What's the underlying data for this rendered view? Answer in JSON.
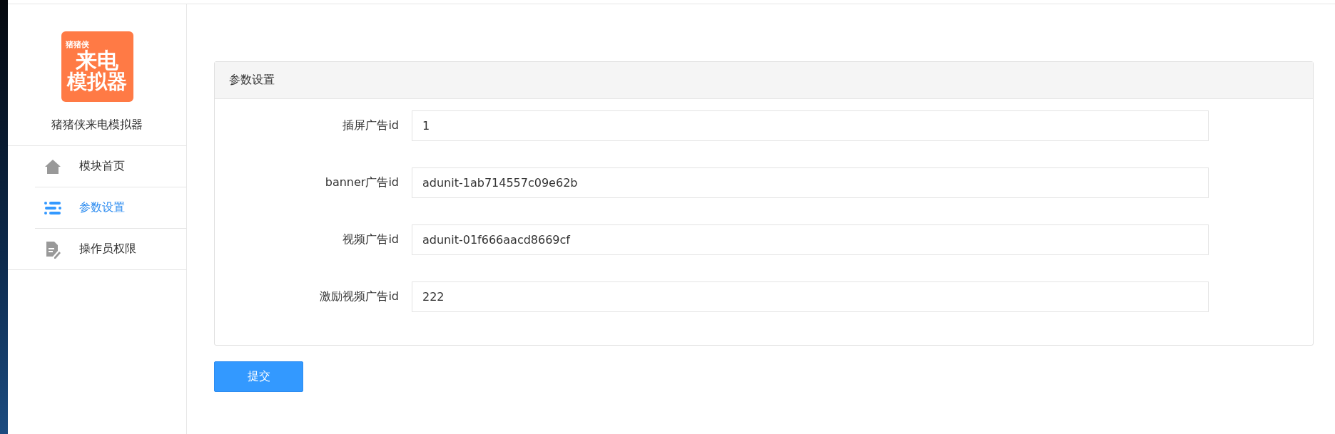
{
  "sidebar": {
    "logo": {
      "lines": [
        "猪猪侠",
        "来电",
        "模拟器"
      ]
    },
    "app_name": "猪猪侠来电模拟器",
    "items": [
      {
        "label": "模块首页",
        "kind": "home",
        "selected": false
      },
      {
        "label": "参数设置",
        "kind": "list",
        "selected": true
      },
      {
        "label": "操作员权限",
        "kind": "doc",
        "selected": false
      }
    ]
  },
  "panel": {
    "title": "参数设置",
    "fields": [
      {
        "label": "插屏广告id",
        "value": "1"
      },
      {
        "label": "banner广告id",
        "value": "adunit-1ab714557c09e62b"
      },
      {
        "label": "视频广告id",
        "value": "adunit-01f666aacd8669cf"
      },
      {
        "label": "激励视频广告id",
        "value": "222"
      }
    ]
  },
  "submit": "提交"
}
